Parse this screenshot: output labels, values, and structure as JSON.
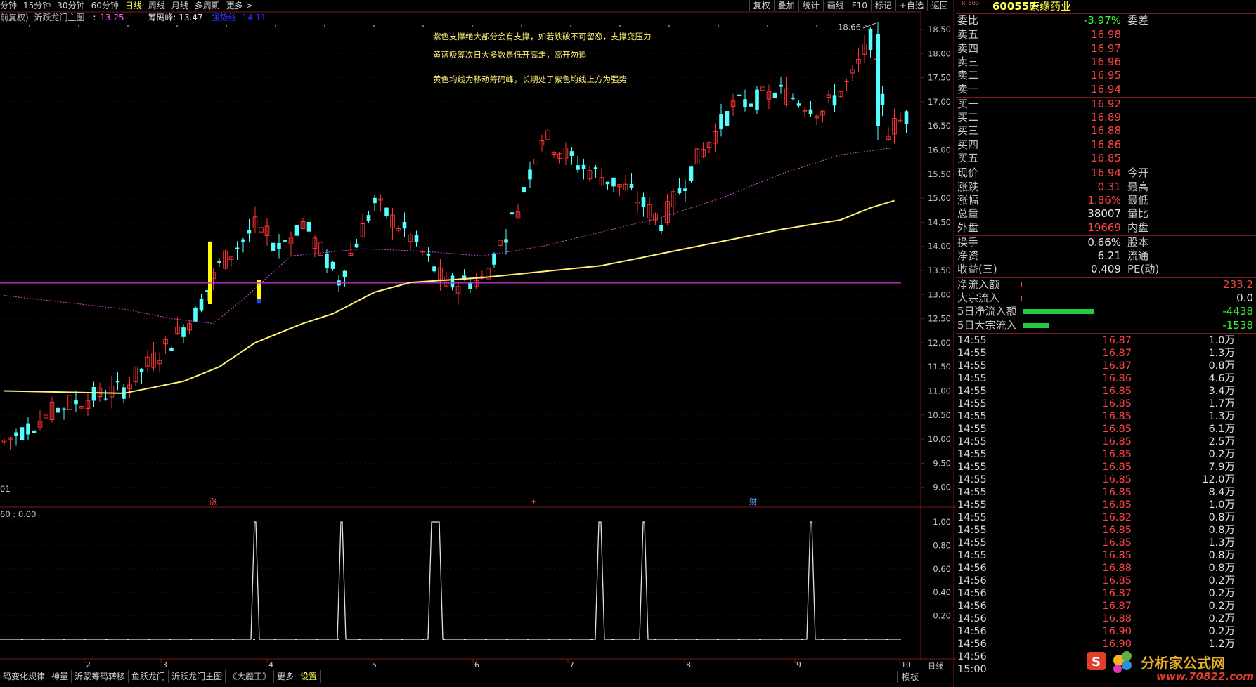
{
  "topbar": {
    "periods": [
      "分钟",
      "15分钟",
      "30分钟",
      "60分钟",
      "日线",
      "周线",
      "月线",
      "多周期",
      "更多 >"
    ],
    "active": "日线"
  },
  "toolbar": [
    "复权",
    "叠加",
    "统计",
    "画线",
    "F10",
    "标记",
    "+自选",
    "返回"
  ],
  "infobar": {
    "adjust": "前复权)",
    "indicator": "沂跃龙门主图",
    "value1": "13.25",
    "chip_label": "筹码峰: 13.47",
    "strong_label": "强势线",
    "strong_value": "14.11"
  },
  "notes": [
    "紫色支撑绝大部分会有支撑，如若跌破不可留恋，支撑变压力",
    "黄蓝吸筹次日大多数是低开高走，高开勿追",
    "黄色均线为移动筹码峰，长期处于紫色均线上方为强势"
  ],
  "price_axis": [
    "18.50",
    "18.00",
    "17.50",
    "17.00",
    "16.50",
    "16.00",
    "15.50",
    "15.00",
    "14.50",
    "14.00",
    "13.50",
    "13.00",
    "12.50",
    "12.00",
    "11.50",
    "11.00",
    "10.50",
    "10.00",
    "9.50",
    "9.00"
  ],
  "sub_axis": [
    "1.00",
    "0.80",
    "0.60",
    "0.40",
    "0.20"
  ],
  "sub_label": "60 : 0.00",
  "left_edge_label": "01",
  "high_label": "18.66",
  "markers": [
    "涨",
    "±",
    "财"
  ],
  "x_axis": [
    "2",
    "3",
    "4",
    "5",
    "6",
    "7",
    "8",
    "9",
    "10"
  ],
  "period_label": "日线",
  "bottom_tabs": [
    "码变化规律",
    "神量",
    "沂蒙筹码转移",
    "鱼跃龙门",
    "沂跃龙门主图",
    "《大魔王》",
    "更多",
    "设置"
  ],
  "bottom_right": "模板",
  "colors": {
    "up": "#ff3333",
    "down": "#54ffff",
    "yellow": "#fff176",
    "purple": "#d64fd6",
    "magenta_line": "#c030c0",
    "green_bar": "#22cc44"
  },
  "quote": {
    "code": "600557",
    "name": "康缘药业",
    "weibi_label": "委比",
    "weibi": "-3.97%",
    "weicha_label": "委差",
    "asks": [
      {
        "label": "卖五",
        "price": "16.98"
      },
      {
        "label": "卖四",
        "price": "16.97"
      },
      {
        "label": "卖三",
        "price": "16.96"
      },
      {
        "label": "卖二",
        "price": "16.95"
      },
      {
        "label": "卖一",
        "price": "16.94"
      }
    ],
    "bids": [
      {
        "label": "买一",
        "price": "16.92"
      },
      {
        "label": "买二",
        "price": "16.89"
      },
      {
        "label": "买三",
        "price": "16.88"
      },
      {
        "label": "买四",
        "price": "16.86"
      },
      {
        "label": "买五",
        "price": "16.85"
      }
    ],
    "stats": [
      {
        "l": "现价",
        "v": "16.94",
        "r": "今开",
        "c": "red"
      },
      {
        "l": "涨跌",
        "v": "0.31",
        "r": "最高",
        "c": "red"
      },
      {
        "l": "涨幅",
        "v": "1.86%",
        "r": "最低",
        "c": "red"
      },
      {
        "l": "总量",
        "v": "38007",
        "r": "量比",
        "c": "white"
      },
      {
        "l": "外盘",
        "v": "19669",
        "r": "内盘",
        "c": "red"
      }
    ],
    "fund": [
      {
        "l": "换手",
        "v": "0.66%",
        "r": "股本"
      },
      {
        "l": "净资",
        "v": "6.21",
        "r": "流通"
      },
      {
        "l": "收益(三)",
        "v": "0.409",
        "r": "PE(动)"
      }
    ],
    "flow": [
      {
        "l": "净流入额",
        "v": "233.2",
        "bar": 0.0,
        "c": "red"
      },
      {
        "l": "大宗流入",
        "v": "0.0",
        "bar": 0.0,
        "c": "white"
      },
      {
        "l": "5日净流入额",
        "v": "-4438",
        "bar": 0.56,
        "c": "green"
      },
      {
        "l": "5日大宗流入",
        "v": "-1538",
        "bar": 0.2,
        "c": "green"
      }
    ]
  },
  "ticks": [
    [
      "14:55",
      "16.87",
      "1.0万"
    ],
    [
      "14:55",
      "16.87",
      "1.3万"
    ],
    [
      "14:55",
      "16.87",
      "0.8万"
    ],
    [
      "14:55",
      "16.86",
      "4.6万"
    ],
    [
      "14:55",
      "16.85",
      "3.4万"
    ],
    [
      "14:55",
      "16.85",
      "1.7万"
    ],
    [
      "14:55",
      "16.85",
      "1.3万"
    ],
    [
      "14:55",
      "16.85",
      "6.1万"
    ],
    [
      "14:55",
      "16.85",
      "2.5万"
    ],
    [
      "14:55",
      "16.85",
      "0.2万"
    ],
    [
      "14:55",
      "16.85",
      "7.9万"
    ],
    [
      "14:55",
      "16.85",
      "12.0万"
    ],
    [
      "14:55",
      "16.85",
      "8.4万"
    ],
    [
      "14:55",
      "16.85",
      "1.0万"
    ],
    [
      "14:55",
      "16.82",
      "0.8万"
    ],
    [
      "14:55",
      "16.85",
      "0.8万"
    ],
    [
      "14:55",
      "16.85",
      "1.3万"
    ],
    [
      "14:55",
      "16.85",
      "0.8万"
    ],
    [
      "14:56",
      "16.88",
      "0.8万"
    ],
    [
      "14:56",
      "16.85",
      "0.2万"
    ],
    [
      "14:56",
      "16.87",
      "0.2万"
    ],
    [
      "14:56",
      "16.87",
      "0.2万"
    ],
    [
      "14:56",
      "16.88",
      "0.2万"
    ],
    [
      "14:56",
      "16.90",
      "0.2万"
    ],
    [
      "14:56",
      "16.90",
      "1.2万"
    ],
    [
      "14:56",
      "16.85",
      "3.2万"
    ],
    [
      "15:00",
      "",
      ""
    ]
  ],
  "watermark": "分析家公式网",
  "watermark_url": "www.70822.com"
}
